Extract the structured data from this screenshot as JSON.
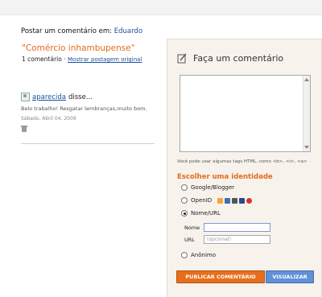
{
  "header": {
    "postar_label": "Postar um comentário em:",
    "blog_name": "Eduardo"
  },
  "post": {
    "title": "\"Comércio inhambupense\"",
    "comment_count": "1 comentário",
    "separator": "·",
    "show_original_link": "Mostrar postagem original"
  },
  "comment": {
    "author": "aparecida",
    "said": "disse...",
    "text": "Belo trabalho! Resgatar lembranças,muito bom.",
    "date": "Sábado, Abril 04, 2009"
  },
  "form": {
    "title": "Faça um comentário",
    "html_hint": "Você pode usar algumas tags HTML, como <b>, <i>, <a>",
    "identity_title": "Escolher uma identidade",
    "options": [
      {
        "label": "Google/Blogger",
        "checked": false
      },
      {
        "label": "OpenID",
        "checked": false
      },
      {
        "label": "Nome/URL",
        "checked": true
      },
      {
        "label": "Anônimo",
        "checked": false
      }
    ],
    "name_label": "Nome",
    "url_label": "URL",
    "url_placeholder": "(opcional)",
    "publish_button": "PUBLICAR COMENTÁRIO",
    "preview_button": "VISUALIZAR"
  },
  "colors": {
    "accent_orange": "#e46a1c",
    "link_blue": "#1a4f9e",
    "publish_button": "#e76e1e",
    "preview_button": "#5f90d8"
  },
  "openid_icons": [
    "openid-provider-icon",
    "livejournal-icon",
    "wordpress-icon",
    "typepad-icon",
    "aim-icon"
  ]
}
